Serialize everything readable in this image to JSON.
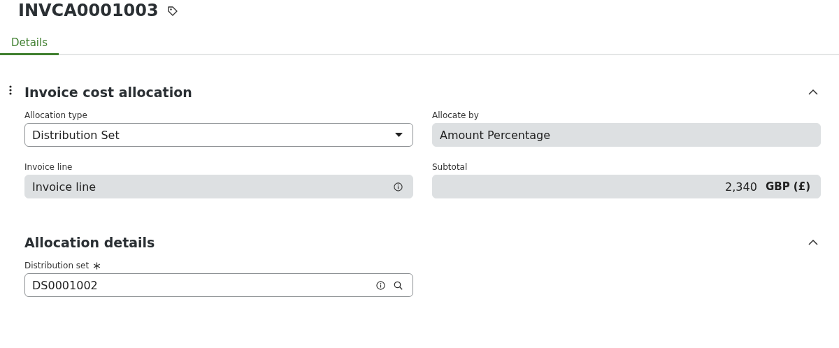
{
  "title": "INVCA0001003",
  "tabs": [
    {
      "label": "Details",
      "selected": true
    }
  ],
  "sections": [
    {
      "title": "Invoice cost allocation",
      "menu": true,
      "expanded": true,
      "fields": [
        {
          "label": "Allocation type",
          "kind": "select",
          "value": "Distribution Set",
          "required": false,
          "info": false
        },
        {
          "label": "Allocate by",
          "kind": "readonly",
          "value": "Amount Percentage",
          "required": false,
          "info": false
        },
        {
          "label": "Invoice line",
          "kind": "readonly",
          "value": "Invoice line",
          "required": false,
          "info": true
        },
        {
          "label": "Subtotal",
          "kind": "amount",
          "value": "2,340",
          "currency": "GBP (£)",
          "required": false,
          "info": false
        }
      ]
    },
    {
      "title": "Allocation details",
      "menu": false,
      "expanded": true,
      "fields": [
        {
          "label": "Distribution set",
          "kind": "lookup",
          "value": "DS0001002",
          "required": true,
          "info": true
        }
      ]
    }
  ]
}
